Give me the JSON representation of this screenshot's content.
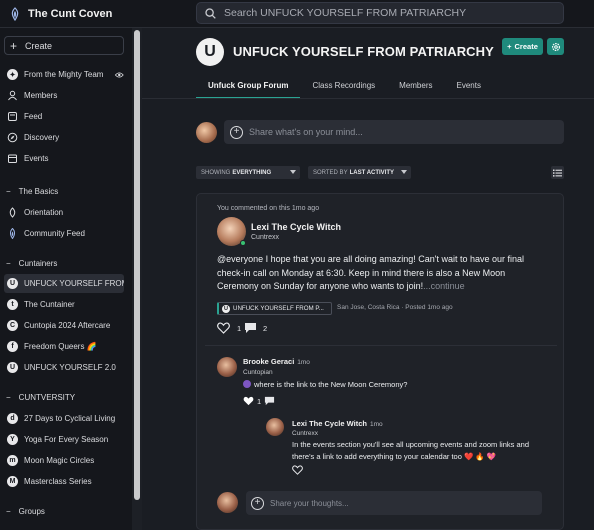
{
  "app": {
    "name": "The Cunt Coven",
    "search_placeholder": "Search UNFUCK YOURSELF FROM PATRIARCHY"
  },
  "sidebar": {
    "create_label": "Create",
    "top_items": [
      {
        "label": "From the Mighty Team",
        "icon": "from-team-icon"
      },
      {
        "label": "Members",
        "icon": "members-icon"
      },
      {
        "label": "Feed",
        "icon": "feed-icon"
      },
      {
        "label": "Discovery",
        "icon": "compass-icon"
      },
      {
        "label": "Events",
        "icon": "calendar-icon"
      }
    ],
    "basics_title": "The Basics",
    "basics_items": [
      {
        "label": "Orientation",
        "icon": "leaf-icon"
      },
      {
        "label": "Community Feed",
        "icon": "logo-icon"
      }
    ],
    "containers_title": "Cuntainers",
    "containers_items": [
      {
        "label": "UNFUCK YOURSELF FROM PATRIARCHY",
        "letter": "U"
      },
      {
        "label": "The Cuntainer",
        "letter": "t"
      },
      {
        "label": "Cuntopia 2024 Aftercare",
        "letter": "C"
      },
      {
        "label": "Freedom Queers 🌈",
        "letter": "f"
      },
      {
        "label": "UNFUCK YOURSELF 2.0",
        "letter": "U"
      }
    ],
    "cuntversity_title": "CUNTVERSITY",
    "cuntversity_items": [
      {
        "label": "27 Days to Cyclical Living",
        "letter": "d"
      },
      {
        "label": "Yoga For Every Season",
        "letter": "Y"
      },
      {
        "label": "Moon Magic Circles",
        "letter": "m"
      },
      {
        "label": "Masterclass Series",
        "letter": "M"
      }
    ],
    "groups_title": "Groups"
  },
  "group": {
    "avatar_letter": "U",
    "title": "UNFUCK YOURSELF FROM PATRIARCHY",
    "create_label": "Create",
    "tabs": [
      "Unfuck Group Forum",
      "Class Recordings",
      "Members",
      "Events"
    ]
  },
  "composer": {
    "placeholder": "Share what's on your mind..."
  },
  "filters": {
    "showing_prefix": "SHOWING",
    "showing_value": "EVERYTHING",
    "sorted_prefix": "SORTED BY",
    "sorted_value": "LAST ACTIVITY"
  },
  "post": {
    "context": "You commented on this 1mo ago",
    "author": "Lexi The Cycle Witch",
    "author_location": "Cuntrexx",
    "body": "@everyone I hope that you are all doing amazing! Can't wait to have our final check-in call on Monday at 6:30. Keep in mind there is also a New Moon Ceremony on Sunday for anyone who wants to join!",
    "continue_label": "...continue",
    "tag": "UNFUCK YOURSELF FROM P...",
    "meta": "San Jose, Costa Rica · Posted 1mo ago",
    "likes": "1",
    "comments": "2"
  },
  "comments": [
    {
      "author": "Brooke Geraci",
      "time": "1mo",
      "location": "Cuntopian",
      "text": "where is the link to the New Moon Ceremony?",
      "likes": "1"
    },
    {
      "author": "Lexi The Cycle Witch",
      "time": "1mo",
      "location": "Cuntrexx",
      "text": "In the events section you'll see all upcoming events and zoom links and there's a link to add everything to your calendar too ❤️ 🔥 💖"
    }
  ],
  "reply": {
    "placeholder": "Share your thoughts..."
  }
}
